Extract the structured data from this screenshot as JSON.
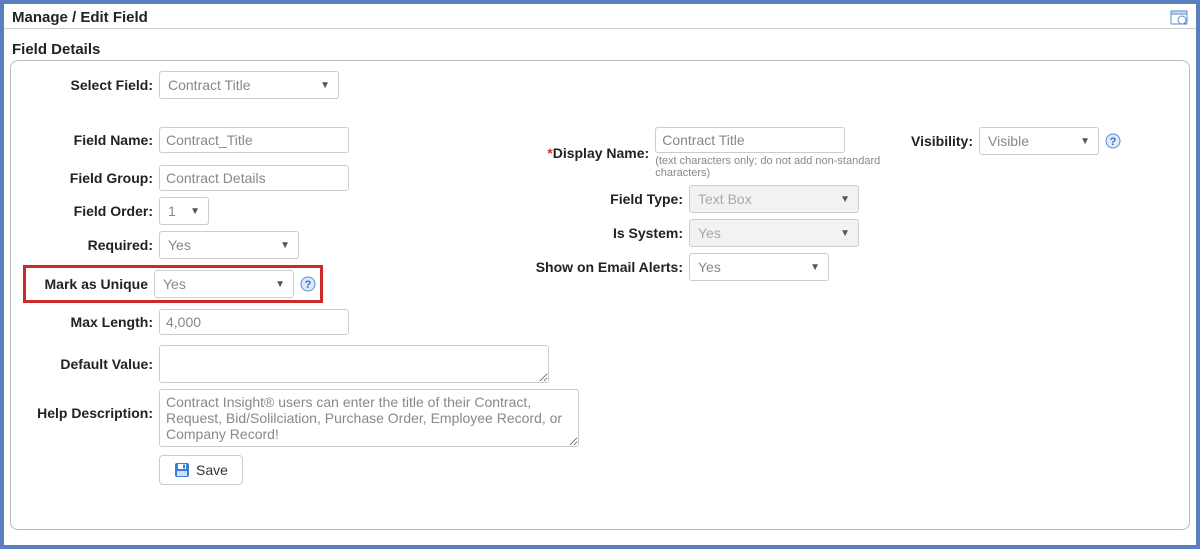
{
  "header": {
    "title": "Manage / Edit Field"
  },
  "section": {
    "title": "Field Details"
  },
  "labels": {
    "select_field": "Select Field:",
    "field_name": "Field Name:",
    "field_group": "Field Group:",
    "field_order": "Field Order:",
    "required": "Required:",
    "mark_unique": "Mark as Unique",
    "max_length": "Max Length:",
    "default_value": "Default Value:",
    "help_description": "Help Description:",
    "display_name": "Display Name:",
    "field_type": "Field Type:",
    "is_system": "Is System:",
    "show_email": "Show on Email Alerts:",
    "visibility": "Visibility:"
  },
  "values": {
    "select_field": "Contract Title",
    "field_name": "Contract_Title",
    "field_group": "Contract Details",
    "field_order": "1",
    "required": "Yes",
    "mark_unique": "Yes",
    "max_length": "4,000",
    "default_value": "",
    "help_description": "Contract Insight® users can enter the title of their Contract, Request, Bid/Solilciation, Purchase Order, Employee Record, or Company Record!",
    "display_name": "Contract Title",
    "display_name_hint": "(text characters only; do not add non-standard characters)",
    "field_type": "Text Box",
    "is_system": "Yes",
    "show_email": "Yes",
    "visibility": "Visible"
  },
  "buttons": {
    "save": "Save"
  }
}
